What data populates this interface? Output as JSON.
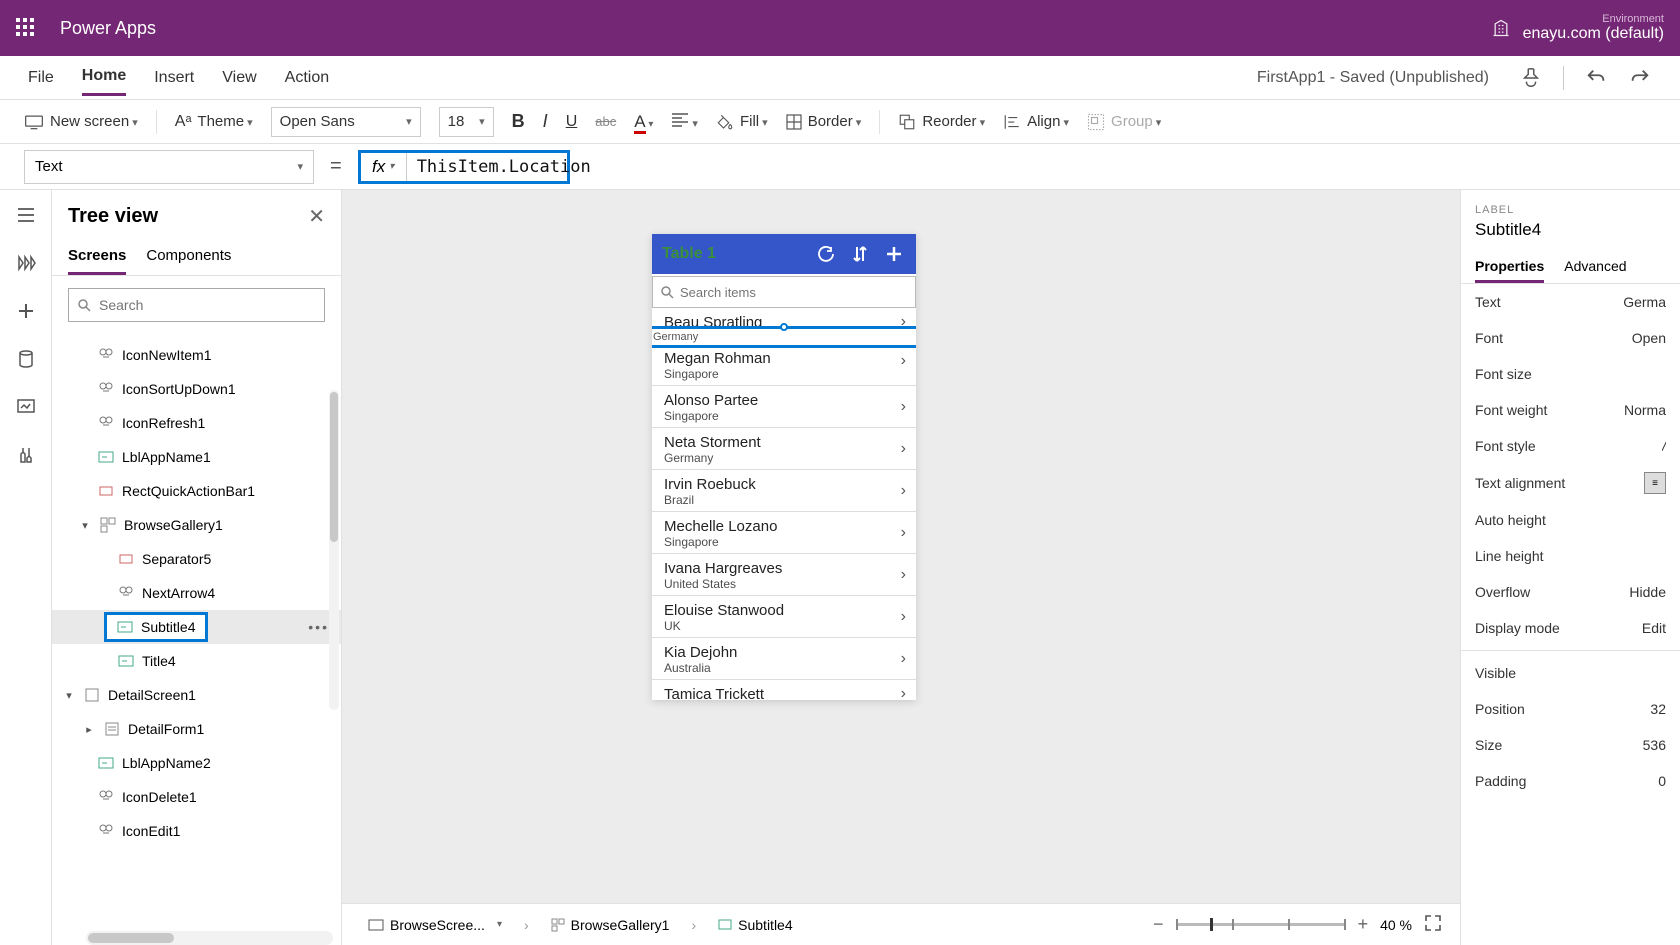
{
  "topbar": {
    "brand": "Power Apps",
    "env_label": "Environment",
    "env_value": "enayu.com (default)"
  },
  "menu": {
    "file": "File",
    "home": "Home",
    "insert": "Insert",
    "view": "View",
    "action": "Action",
    "doc_title": "FirstApp1 - Saved (Unpublished)"
  },
  "toolbar": {
    "new_screen": "New screen",
    "theme": "Theme",
    "font": "Open Sans",
    "size": "18",
    "fill": "Fill",
    "border": "Border",
    "reorder": "Reorder",
    "align": "Align",
    "group": "Group"
  },
  "formula": {
    "property": "Text",
    "expression": "ThisItem.Location"
  },
  "treeview": {
    "title": "Tree view",
    "tab_screens": "Screens",
    "tab_components": "Components",
    "search_placeholder": "Search",
    "items": {
      "icon_new": "IconNewItem1",
      "icon_sort": "IconSortUpDown1",
      "icon_refresh": "IconRefresh1",
      "lbl_app1": "LblAppName1",
      "rect_qab": "RectQuickActionBar1",
      "browse_gal": "BrowseGallery1",
      "separator": "Separator5",
      "next_arrow": "NextArrow4",
      "subtitle": "Subtitle4",
      "title4": "Title4",
      "detail_scr": "DetailScreen1",
      "detail_form": "DetailForm1",
      "lbl_app2": "LblAppName2",
      "icon_delete": "IconDelete1",
      "icon_edit": "IconEdit1"
    }
  },
  "phone": {
    "title": "Table 1",
    "search_placeholder": "Search items",
    "rows": [
      {
        "name": "Beau Spratling",
        "loc": "Germany"
      },
      {
        "name": "Megan Rohman",
        "loc": "Singapore"
      },
      {
        "name": "Alonso Partee",
        "loc": "Singapore"
      },
      {
        "name": "Neta Storment",
        "loc": "Germany"
      },
      {
        "name": "Irvin Roebuck",
        "loc": "Brazil"
      },
      {
        "name": "Mechelle Lozano",
        "loc": "Singapore"
      },
      {
        "name": "Ivana Hargreaves",
        "loc": "United States"
      },
      {
        "name": "Elouise Stanwood",
        "loc": "UK"
      },
      {
        "name": "Kia Dejohn",
        "loc": "Australia"
      },
      {
        "name": "Tamica Trickett",
        "loc": ""
      }
    ],
    "selected_text": "Germany"
  },
  "breadcrumb": {
    "screen": "BrowseScree...",
    "gallery": "BrowseGallery1",
    "control": "Subtitle4",
    "zoom": "40",
    "zoom_unit": "%"
  },
  "properties": {
    "type_label": "LABEL",
    "control_name": "Subtitle4",
    "tab_props": "Properties",
    "tab_adv": "Advanced",
    "rows": {
      "text_l": "Text",
      "text_v": "Germa",
      "font_l": "Font",
      "font_v": "Open",
      "fsize_l": "Font size",
      "fw_l": "Font weight",
      "fw_v": "Norma",
      "fstyle_l": "Font style",
      "fstyle_v": "/",
      "talign_l": "Text alignment",
      "ah_l": "Auto height",
      "lh_l": "Line height",
      "ovf_l": "Overflow",
      "ovf_v": "Hidde",
      "dm_l": "Display mode",
      "dm_v": "Edit",
      "vis_l": "Visible",
      "pos_l": "Position",
      "pos_v": "32",
      "size_l": "Size",
      "size_v": "536",
      "pad_l": "Padding",
      "pad_v": "0"
    }
  }
}
